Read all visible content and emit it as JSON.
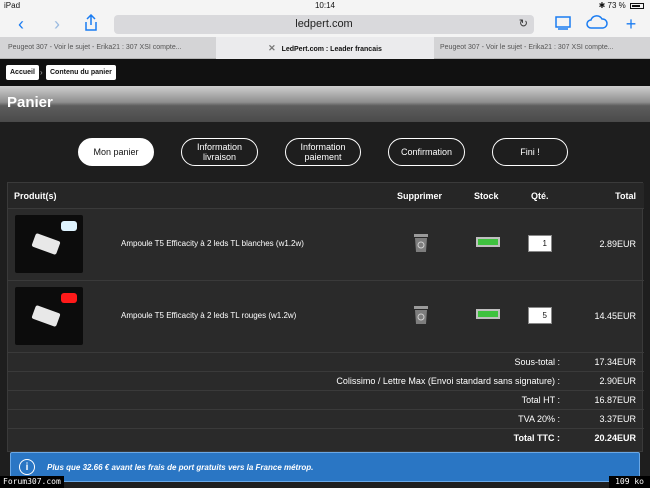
{
  "status_bar": {
    "carrier": "iPad",
    "time": "10:14",
    "battery": "73 %"
  },
  "browser": {
    "url": "ledpert.com",
    "tabs": [
      {
        "label": "Peugeot 307 - Voir le sujet - Erika21 : 307 XSI compte..."
      },
      {
        "label": "LedPert.com : Leader francais"
      },
      {
        "label": "Peugeot 307 - Voir le sujet - Erika21 : 307 XSI compte..."
      }
    ]
  },
  "breadcrumb": {
    "home": "Accueil",
    "current": "Contenu du panier"
  },
  "page_title": "Panier",
  "steps": [
    {
      "label": "Mon panier"
    },
    {
      "label": "Information livraison"
    },
    {
      "label": "Information paiement"
    },
    {
      "label": "Confirmation"
    },
    {
      "label": "Fini !"
    }
  ],
  "table": {
    "headers": {
      "product": "Produit(s)",
      "delete": "Supprimer",
      "stock": "Stock",
      "qty": "Qté.",
      "total": "Total"
    },
    "rows": [
      {
        "name": "Ampoule T5 Efficacity à 2 leds TL blanches (w1.2w)",
        "qty": "1",
        "total": "2.89EUR",
        "glow_color": "#dff4ff"
      },
      {
        "name": "Ampoule T5 Efficacity à 2 leds TL rouges (w1.2w)",
        "qty": "5",
        "total": "14.45EUR",
        "glow_color": "#ff1a1a"
      }
    ],
    "summary": [
      {
        "label": "Sous-total :",
        "value": "17.34EUR"
      },
      {
        "label": "Colissimo / Lettre Max (Envoi standard sans signature) :",
        "value": "2.90EUR"
      },
      {
        "label": "Total HT :",
        "value": "16.87EUR"
      },
      {
        "label": "TVA 20% :",
        "value": "3.37EUR"
      },
      {
        "label": "Total TTC :",
        "value": "20.24EUR"
      }
    ]
  },
  "info_banner": {
    "icon": "i",
    "text": "Plus que 32.66 € avant les frais de port gratuits vers la France métrop."
  },
  "watermark": {
    "left": "Forum307.com",
    "right": "109 ko"
  },
  "colors": {
    "accent": "#1a7cf2",
    "stock_ok": "#3fc23f",
    "banner": "#2a76c4"
  }
}
